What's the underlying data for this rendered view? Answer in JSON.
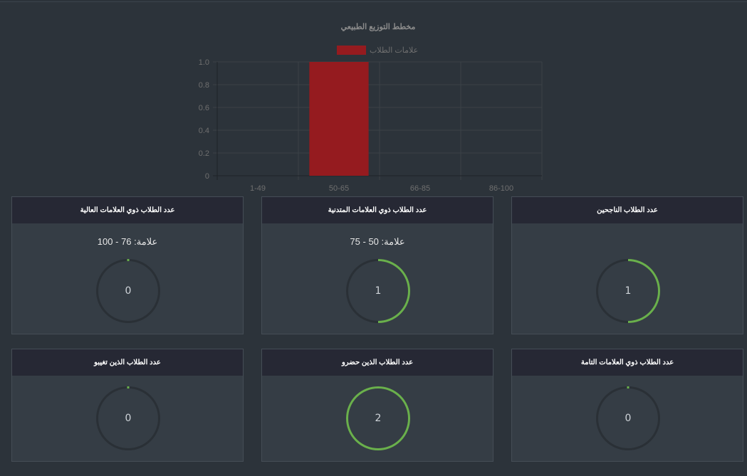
{
  "chart_data": {
    "type": "bar",
    "title": "مخطط التوزيع الطبيعي",
    "categories": [
      "1-49",
      "50-65",
      "66-85",
      "86-100"
    ],
    "series": [
      {
        "name": "علامات الطلاب",
        "values": [
          0,
          1,
          0,
          0
        ],
        "color": "#951b1f"
      }
    ],
    "ylim": [
      0,
      1
    ],
    "yticks": [
      "0",
      "0.2",
      "0.4",
      "0.6",
      "0.8",
      "1.0"
    ],
    "grid": true,
    "legend": "top-center"
  },
  "cards": [
    {
      "title": "عدد الطلاب ذوي العلامات العالية",
      "range_label": "علامة: 76 - 100",
      "value": "0",
      "fraction": 0
    },
    {
      "title": "عدد الطلاب ذوي العلامات المتدنية",
      "range_label": "علامة: 50 - 75",
      "value": "1",
      "fraction": 0.5
    },
    {
      "title": "عدد الطلاب الناجحين",
      "range_label": "",
      "value": "1",
      "fraction": 0.5
    },
    {
      "title": "عدد الطلاب الذين تغيبو",
      "range_label": "",
      "value": "0",
      "fraction": 0
    },
    {
      "title": "عدد الطلاب الذين حضرو",
      "range_label": "",
      "value": "2",
      "fraction": 1
    },
    {
      "title": "عدد الطلاب ذوي العلامات التامة",
      "range_label": "",
      "value": "0",
      "fraction": 0
    }
  ],
  "colors": {
    "ring_track": "#2a3036",
    "ring_fill": "#6ab04c"
  }
}
